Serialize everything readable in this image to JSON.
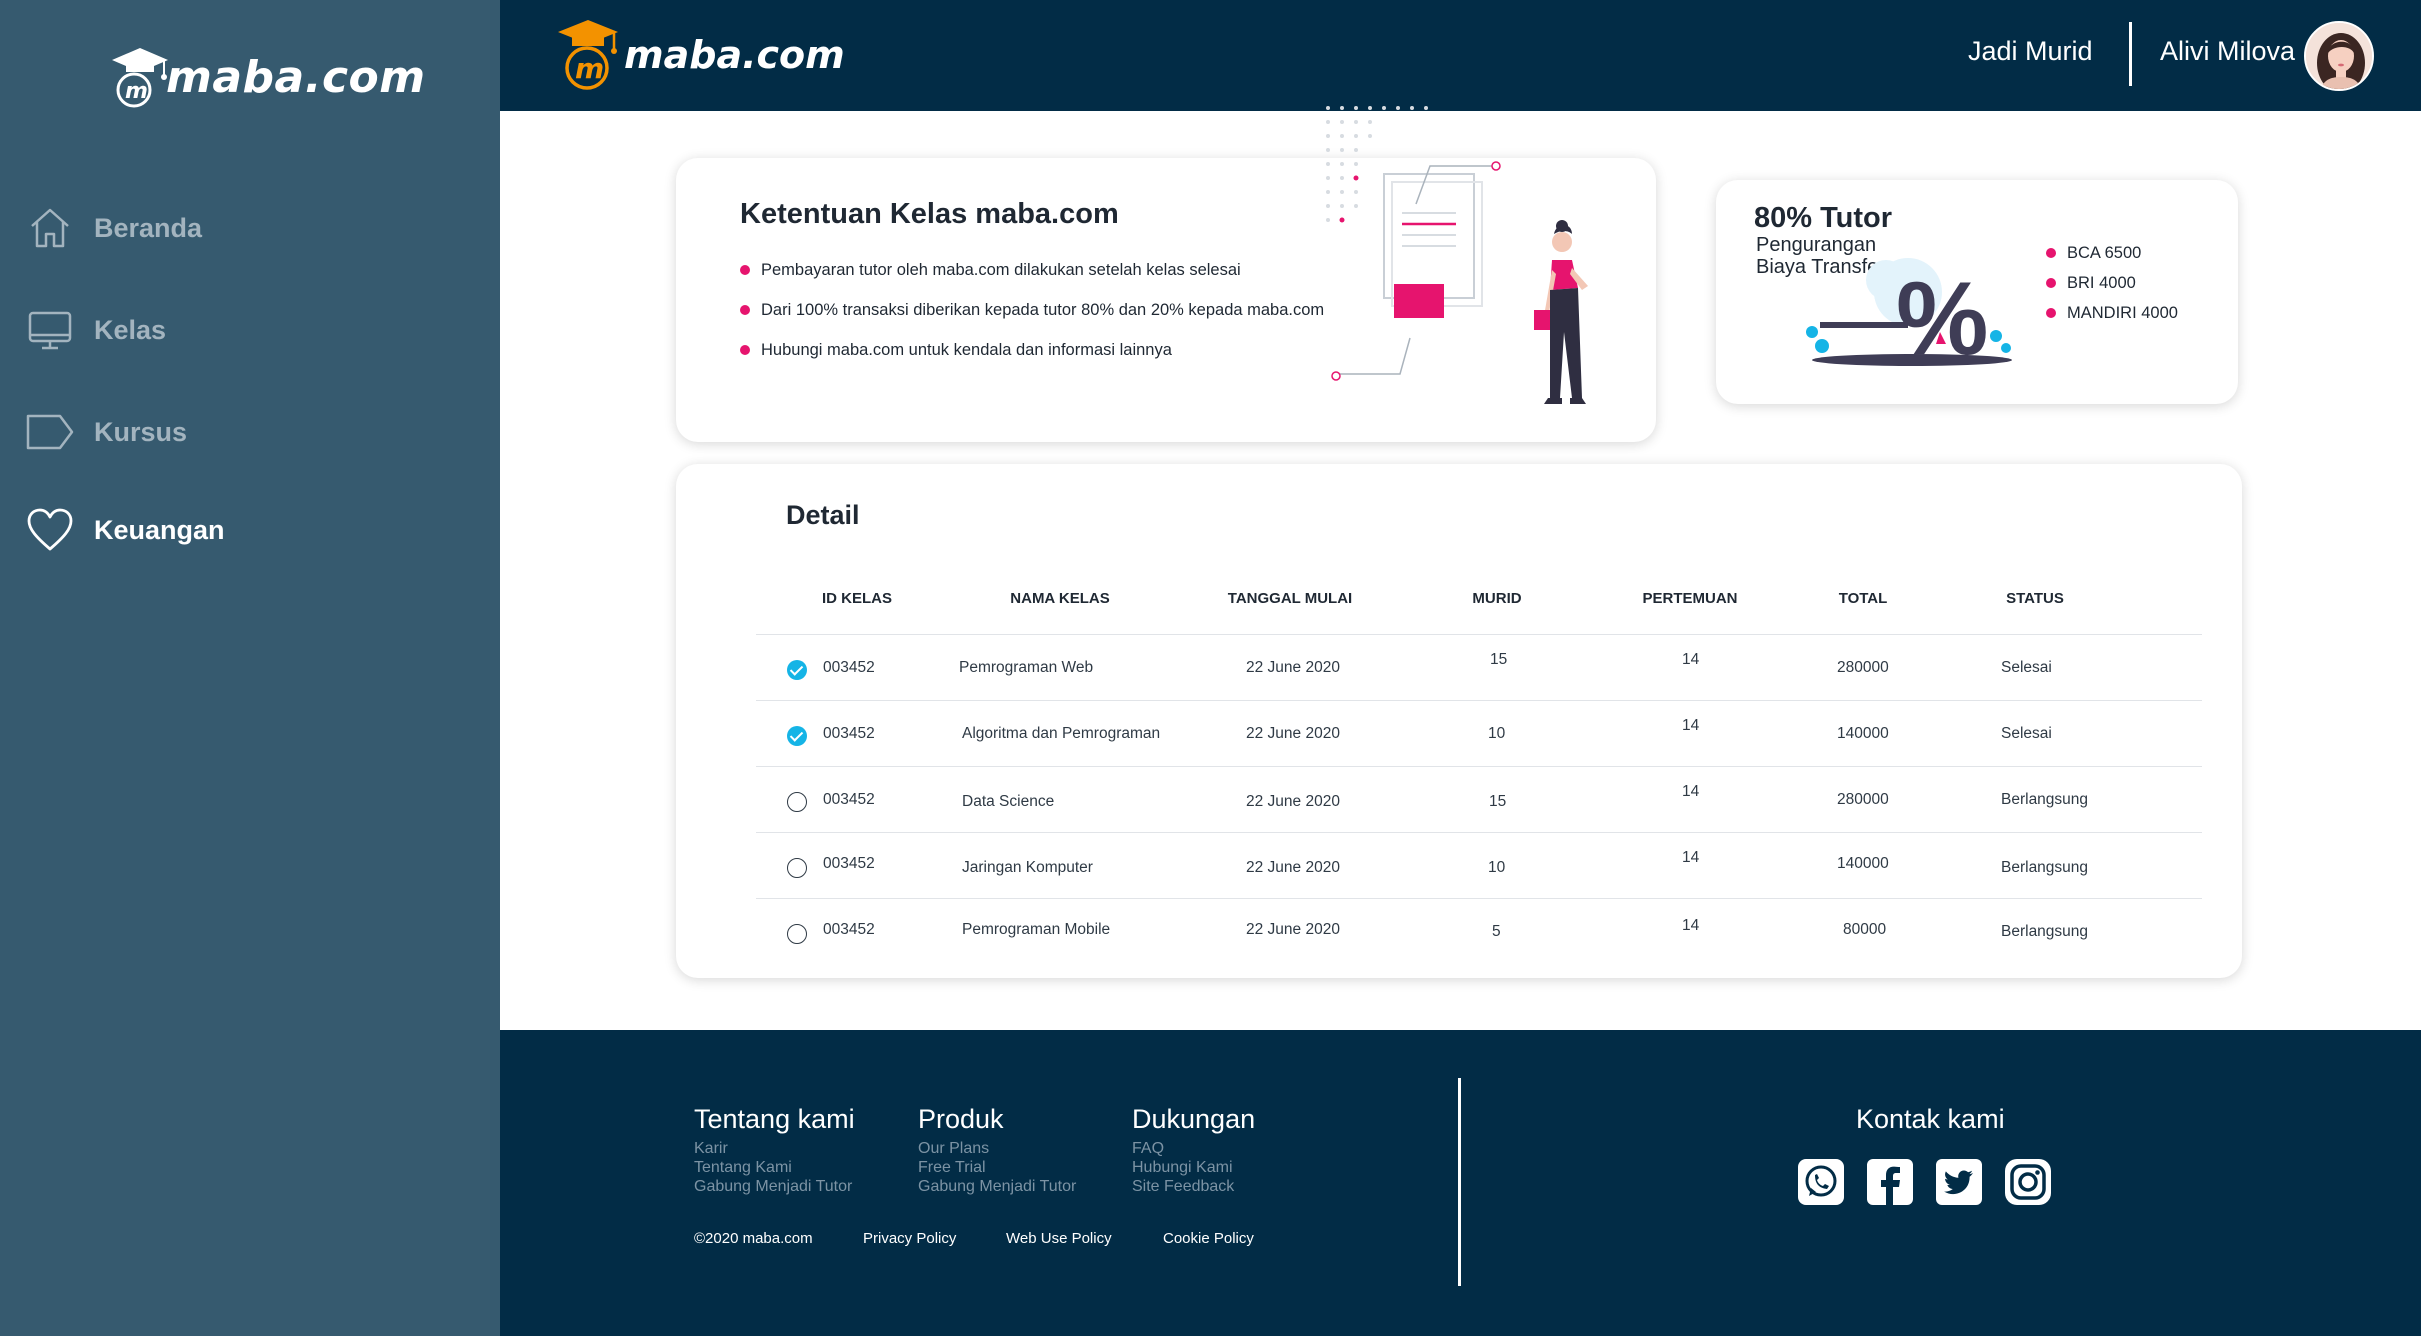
{
  "brand": "maba.com",
  "sidebar": {
    "items": [
      {
        "label": "Beranda",
        "icon": "home-icon"
      },
      {
        "label": "Kelas",
        "icon": "monitor-icon"
      },
      {
        "label": "Kursus",
        "icon": "tag-icon"
      },
      {
        "label": "Keuangan",
        "icon": "heart-icon",
        "active": true
      }
    ]
  },
  "header": {
    "join_label": "Jadi Murid",
    "user_name": "Alivi Milova"
  },
  "rules_card": {
    "title": "Ketentuan Kelas maba.com",
    "items": [
      "Pembayaran tutor oleh maba.com dilakukan setelah kelas selesai",
      "Dari 100% transaksi diberikan kepada tutor 80% dan 20% kepada maba.com",
      "Hubungi maba.com untuk kendala dan informasi lainnya"
    ]
  },
  "tutor_card": {
    "title": "80% Tutor",
    "subtitle_1": "Pengurangan",
    "subtitle_2": "Biaya Transfer",
    "fees": [
      "BCA 6500",
      "BRI 4000",
      "MANDIRI 4000"
    ]
  },
  "detail": {
    "title": "Detail",
    "columns": [
      "ID KELAS",
      "NAMA KELAS",
      "TANGGAL MULAI",
      "MURID",
      "PERTEMUAN",
      "TOTAL",
      "STATUS"
    ],
    "rows": [
      {
        "checked": true,
        "id": "003452",
        "name": "Pemrograman Web",
        "date": "22 June 2020",
        "students": "15",
        "meetings": "14",
        "total": "280000",
        "status": "Selesai"
      },
      {
        "checked": true,
        "id": "003452",
        "name": "Algoritma dan Pemrograman",
        "date": "22 June 2020",
        "students": "10",
        "meetings": "14",
        "total": "140000",
        "status": "Selesai"
      },
      {
        "checked": false,
        "id": "003452",
        "name": "Data Science",
        "date": "22 June 2020",
        "students": "15",
        "meetings": "14",
        "total": "280000",
        "status": "Berlangsung"
      },
      {
        "checked": false,
        "id": "003452",
        "name": "Jaringan Komputer",
        "date": "22 June 2020",
        "students": "10",
        "meetings": "14",
        "total": "140000",
        "status": "Berlangsung"
      },
      {
        "checked": false,
        "id": "003452",
        "name": "Pemrograman Mobile",
        "date": "22 June 2020",
        "students": "5",
        "meetings": "14",
        "total": "80000",
        "status": "Berlangsung"
      }
    ]
  },
  "footer": {
    "about": {
      "title": "Tentang kami",
      "links": [
        "Karir",
        "Tentang Kami",
        "Gabung Menjadi Tutor"
      ]
    },
    "product": {
      "title": "Produk",
      "links": [
        "Our Plans",
        "Free Trial",
        "Gabung Menjadi Tutor"
      ]
    },
    "support": {
      "title": "Dukungan",
      "links": [
        "FAQ",
        "Hubungi Kami",
        "Site Feedback"
      ]
    },
    "copyright": "©2020 maba.com",
    "privacy": "Privacy Policy",
    "web_use": "Web Use Policy",
    "cookie": "Cookie Policy",
    "contact_title": "Kontak kami",
    "social": [
      "whatsapp-icon",
      "facebook-icon",
      "twitter-icon",
      "instagram-icon"
    ]
  },
  "colors": {
    "sidebar": "#365a6f",
    "navy": "#022c46",
    "accent_pink": "#e6146e",
    "check_blue": "#15b4e6",
    "logo_orange": "#f39200"
  }
}
